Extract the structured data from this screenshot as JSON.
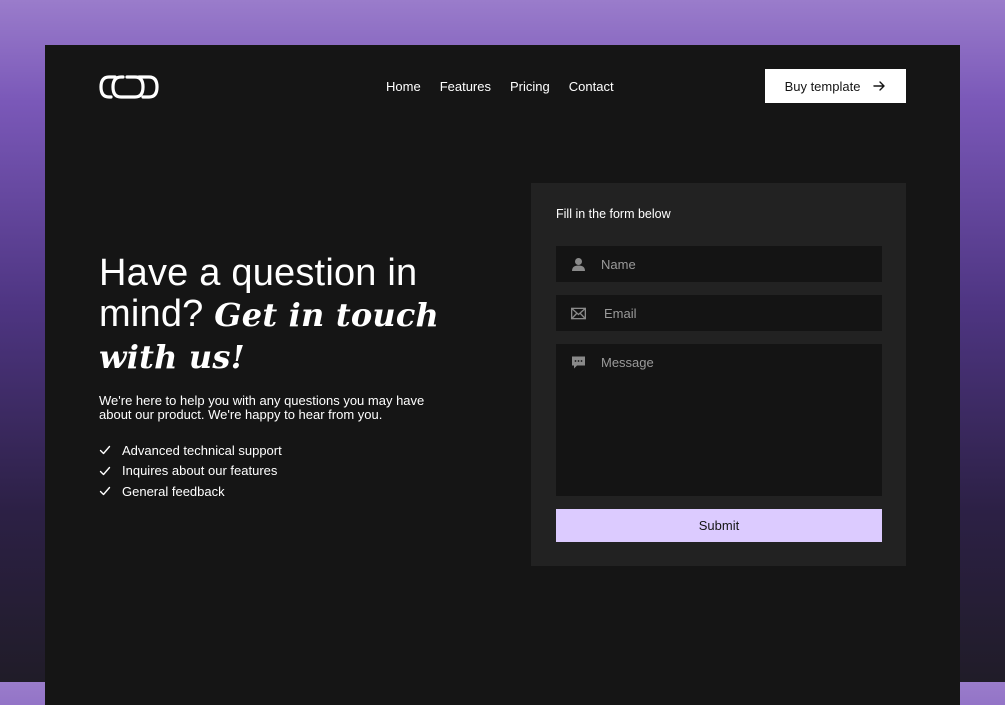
{
  "nav": {
    "logo_icon": "infinity-link-logo",
    "links": [
      "Home",
      "Features",
      "Pricing",
      "Contact"
    ],
    "cta_label": "Buy template",
    "cta_icon": "arrow-right-icon"
  },
  "hero": {
    "title_sans": "Have a question in mind?",
    "title_serif": "Get in touch with us!",
    "subtitle": "We're here to help you with any questions you may have about our product. We're happy to hear from you.",
    "features": [
      "Advanced technical support",
      "Inquires about our features",
      "General feedback"
    ],
    "check_icon": "check-icon"
  },
  "form": {
    "heading": "Fill in the form below",
    "name_placeholder": "Name",
    "email_placeholder": "Email",
    "message_placeholder": "Message",
    "submit_label": "Submit",
    "name_icon": "user-icon",
    "email_icon": "mail-icon",
    "message_icon": "chat-icon"
  },
  "colors": {
    "frame_bg": "#151515",
    "card_bg": "#222222",
    "field_bg": "#141414",
    "submit_bg": "#dccbff",
    "gradient_top": "#9a7ccb",
    "gradient_bottom": "#201c28"
  }
}
